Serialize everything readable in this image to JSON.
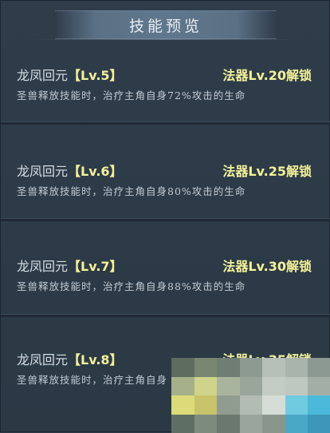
{
  "header": {
    "title": "技能预览"
  },
  "skills": [
    {
      "name": "龙凤回元",
      "level": "【Lv.5】",
      "unlock": "法器Lv.20解锁",
      "desc": "圣兽释放技能时，治疗主角自身72%攻击的生命"
    },
    {
      "name": "龙凤回元",
      "level": "【Lv.6】",
      "unlock": "法器Lv.25解锁",
      "desc": "圣兽释放技能时，治疗主角自身80%攻击的生命"
    },
    {
      "name": "龙凤回元",
      "level": "【Lv.7】",
      "unlock": "法器Lv.30解锁",
      "desc": "圣兽释放技能时，治疗主角自身88%攻击的生命"
    },
    {
      "name": "龙凤回元",
      "level": "【Lv.8】",
      "unlock": "法器Lv.35解锁",
      "desc": "圣兽释放技能时，治疗主角自身"
    }
  ],
  "colors": {
    "accent": "#f3f09a",
    "background": "#2c3a47",
    "text": "#d7dde3"
  },
  "mosaic_colors": [
    "#5d6c5e",
    "#7a8770",
    "#6f7d73",
    "#8d9a92",
    "#b6c0b8",
    "#a9b5ac",
    "#8c9992",
    "#a6b08a",
    "#cfd48a",
    "#a8b49d",
    "#9aa59c",
    "#c4cdc4",
    "#bfc8bf",
    "#a3afa6",
    "#dcdb7a",
    "#c8c26a",
    "#8f9c8f",
    "#b3bcb3",
    "#d6ddd6",
    "#6fcbe0",
    "#4ab9da",
    "#5f6e63",
    "#7d8b7f",
    "#6a786d",
    "#9aa69b",
    "#8a968b",
    "#4aa8c7",
    "#3c97b8"
  ]
}
